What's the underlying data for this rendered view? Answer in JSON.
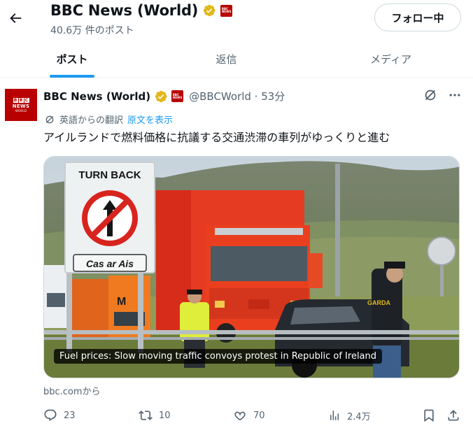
{
  "header": {
    "back_icon": "arrow-left-icon",
    "title": "BBC News (World)",
    "post_count": "40.6万 件のポスト",
    "follow_label": "フォロー中"
  },
  "tabs": [
    {
      "label": "ポスト",
      "active": true
    },
    {
      "label": "返信",
      "active": false
    },
    {
      "label": "メディア",
      "active": false
    }
  ],
  "tweet": {
    "avatar_letters": [
      "B",
      "B",
      "C"
    ],
    "avatar_news": "NEWS",
    "avatar_world": "WORLD",
    "author_name": "BBC News (World)",
    "handle_time": "@BBCWorld · 53分",
    "translate_note": "英語からの翻訳",
    "show_original": "原文を表示",
    "text": "アイルランドで燃料価格に抗議する交通渋滞の車列がゆっくりと進む",
    "media": {
      "sign_top": "TURN BACK",
      "sign_bottom": "Cas ar Ais",
      "truck_brand": "M",
      "vest_text": "GARDA",
      "caption": "Fuel prices: Slow moving traffic convoys protest in Republic of Ireland"
    },
    "card_source": "bbc.comから",
    "actions": {
      "replies": "23",
      "reposts": "10",
      "likes": "70",
      "views": "2.4万"
    }
  },
  "colors": {
    "accent": "#1d9bf0",
    "verified": "#e2b719",
    "bbc_red": "#b80000",
    "secondary_text": "#536471"
  }
}
